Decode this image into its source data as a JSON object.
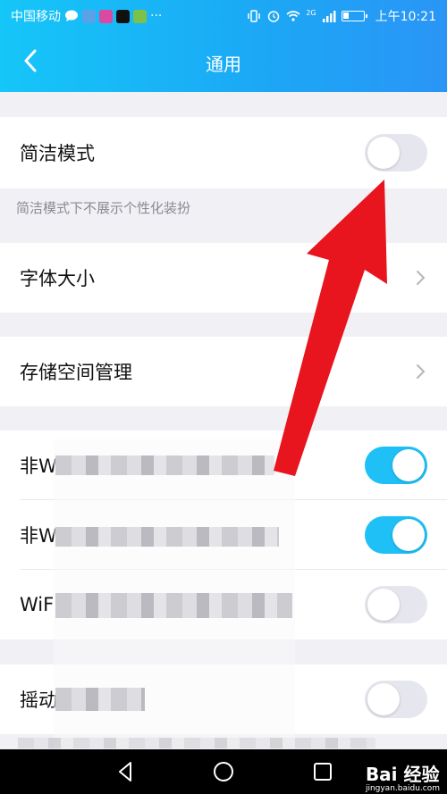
{
  "status_bar": {
    "carrier": "中国移动",
    "more": "···",
    "network_badge": "2G",
    "time": "上午10:21"
  },
  "header": {
    "title": "通用"
  },
  "settings": {
    "simple_mode": {
      "label": "简洁模式",
      "enabled": false
    },
    "simple_mode_note": "简洁模式下不展示个性化装扮",
    "font_size": {
      "label": "字体大小"
    },
    "storage": {
      "label": "存储空间管理"
    },
    "non_wifi_1": {
      "label": "非W",
      "enabled": true
    },
    "non_wifi_2": {
      "label": "非W",
      "enabled": true
    },
    "wifi": {
      "label": "WiF",
      "enabled": false
    },
    "shake": {
      "label": "摇动",
      "enabled": false
    }
  },
  "watermark": {
    "brand": "Bai 经验",
    "url": "jingyan.baidu.com"
  },
  "colors": {
    "header_start": "#15c6f8",
    "header_end": "#2a95f6",
    "toggle_on": "#1ec0f6",
    "toggle_off": "#e6e7ee",
    "annotation_arrow": "#e8141e"
  }
}
